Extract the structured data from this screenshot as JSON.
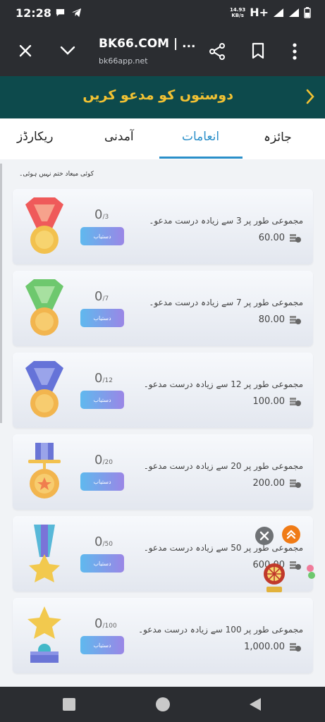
{
  "status_bar": {
    "time": "12:28",
    "network_speed": "14.93",
    "speed_unit": "KB/s",
    "network_type": "H+"
  },
  "browser": {
    "title": "BK66.COM | ...",
    "url": "bk66app.net"
  },
  "banner": {
    "title": "دوستوں کو مدعو کریں"
  },
  "tabs": [
    {
      "label": "جائزہ"
    },
    {
      "label": "انعامات"
    },
    {
      "label": "آمدنی"
    },
    {
      "label": "ریکارڈز"
    }
  ],
  "active_tab": "انعامات",
  "note": "کوئی میعاد ختم نہیں ہوئی۔",
  "rewards": [
    {
      "current": "0",
      "total": "3",
      "button": "دستیاب",
      "condition": "مجموعی طور پر 3 سے زیادہ درست مدعو۔",
      "amount": "60.00",
      "medal": "red-ribbon-medal"
    },
    {
      "current": "0",
      "total": "7",
      "button": "دستیاب",
      "condition": "مجموعی طور پر 7 سے زیادہ درست مدعو۔",
      "amount": "80.00",
      "medal": "green-ribbon-medal"
    },
    {
      "current": "0",
      "total": "12",
      "button": "دستیاب",
      "condition": "مجموعی طور پر 12 سے زیادہ درست مدعو۔",
      "amount": "100.00",
      "medal": "blue-ribbon-medal"
    },
    {
      "current": "0",
      "total": "20",
      "button": "دستیاب",
      "condition": "مجموعی طور پر 20 سے زیادہ درست مدعو۔",
      "amount": "200.00",
      "medal": "purple-bar-medal"
    },
    {
      "current": "0",
      "total": "50",
      "button": "دستیاب",
      "condition": "مجموعی طور پر 50 سے زیادہ درست مدعو۔",
      "amount": "600.00",
      "medal": "star-ribbon-medal"
    },
    {
      "current": "0",
      "total": "100",
      "button": "دستیاب",
      "condition": "مجموعی طور پر 100 سے زیادہ درست مدعو۔",
      "amount": "1,000.00",
      "medal": "star-trophy"
    }
  ],
  "colors": {
    "banner_bg": "#0d4a4c",
    "banner_text": "#f2c233",
    "active_tab": "#2a8fc9",
    "chrome": "#2b2d31"
  }
}
